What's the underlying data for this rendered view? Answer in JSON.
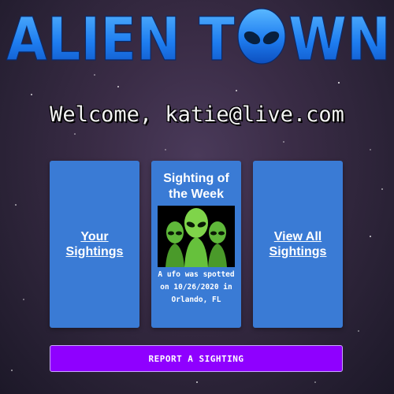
{
  "logo": {
    "left_text": "ALIEN T",
    "right_text": "WN",
    "icon": "alien-head-icon"
  },
  "welcome": {
    "text": "Welcome, katie@live.com"
  },
  "cards": {
    "your_sightings": "Your Sightings",
    "sighting_of_week_title": "Sighting of the Week",
    "sighting_of_week_image": "three-green-aliens-image",
    "sighting_of_week_desc": "A ufo was spotted on 10/26/2020 in Orlando, FL",
    "view_all": "View All Sightings"
  },
  "report_button": {
    "label": "REPORT A SIGHTING"
  },
  "colors": {
    "card_blue": "#3a7bd5",
    "report_purple": "#8f00ff",
    "logo_blue": "#2a8cff"
  }
}
